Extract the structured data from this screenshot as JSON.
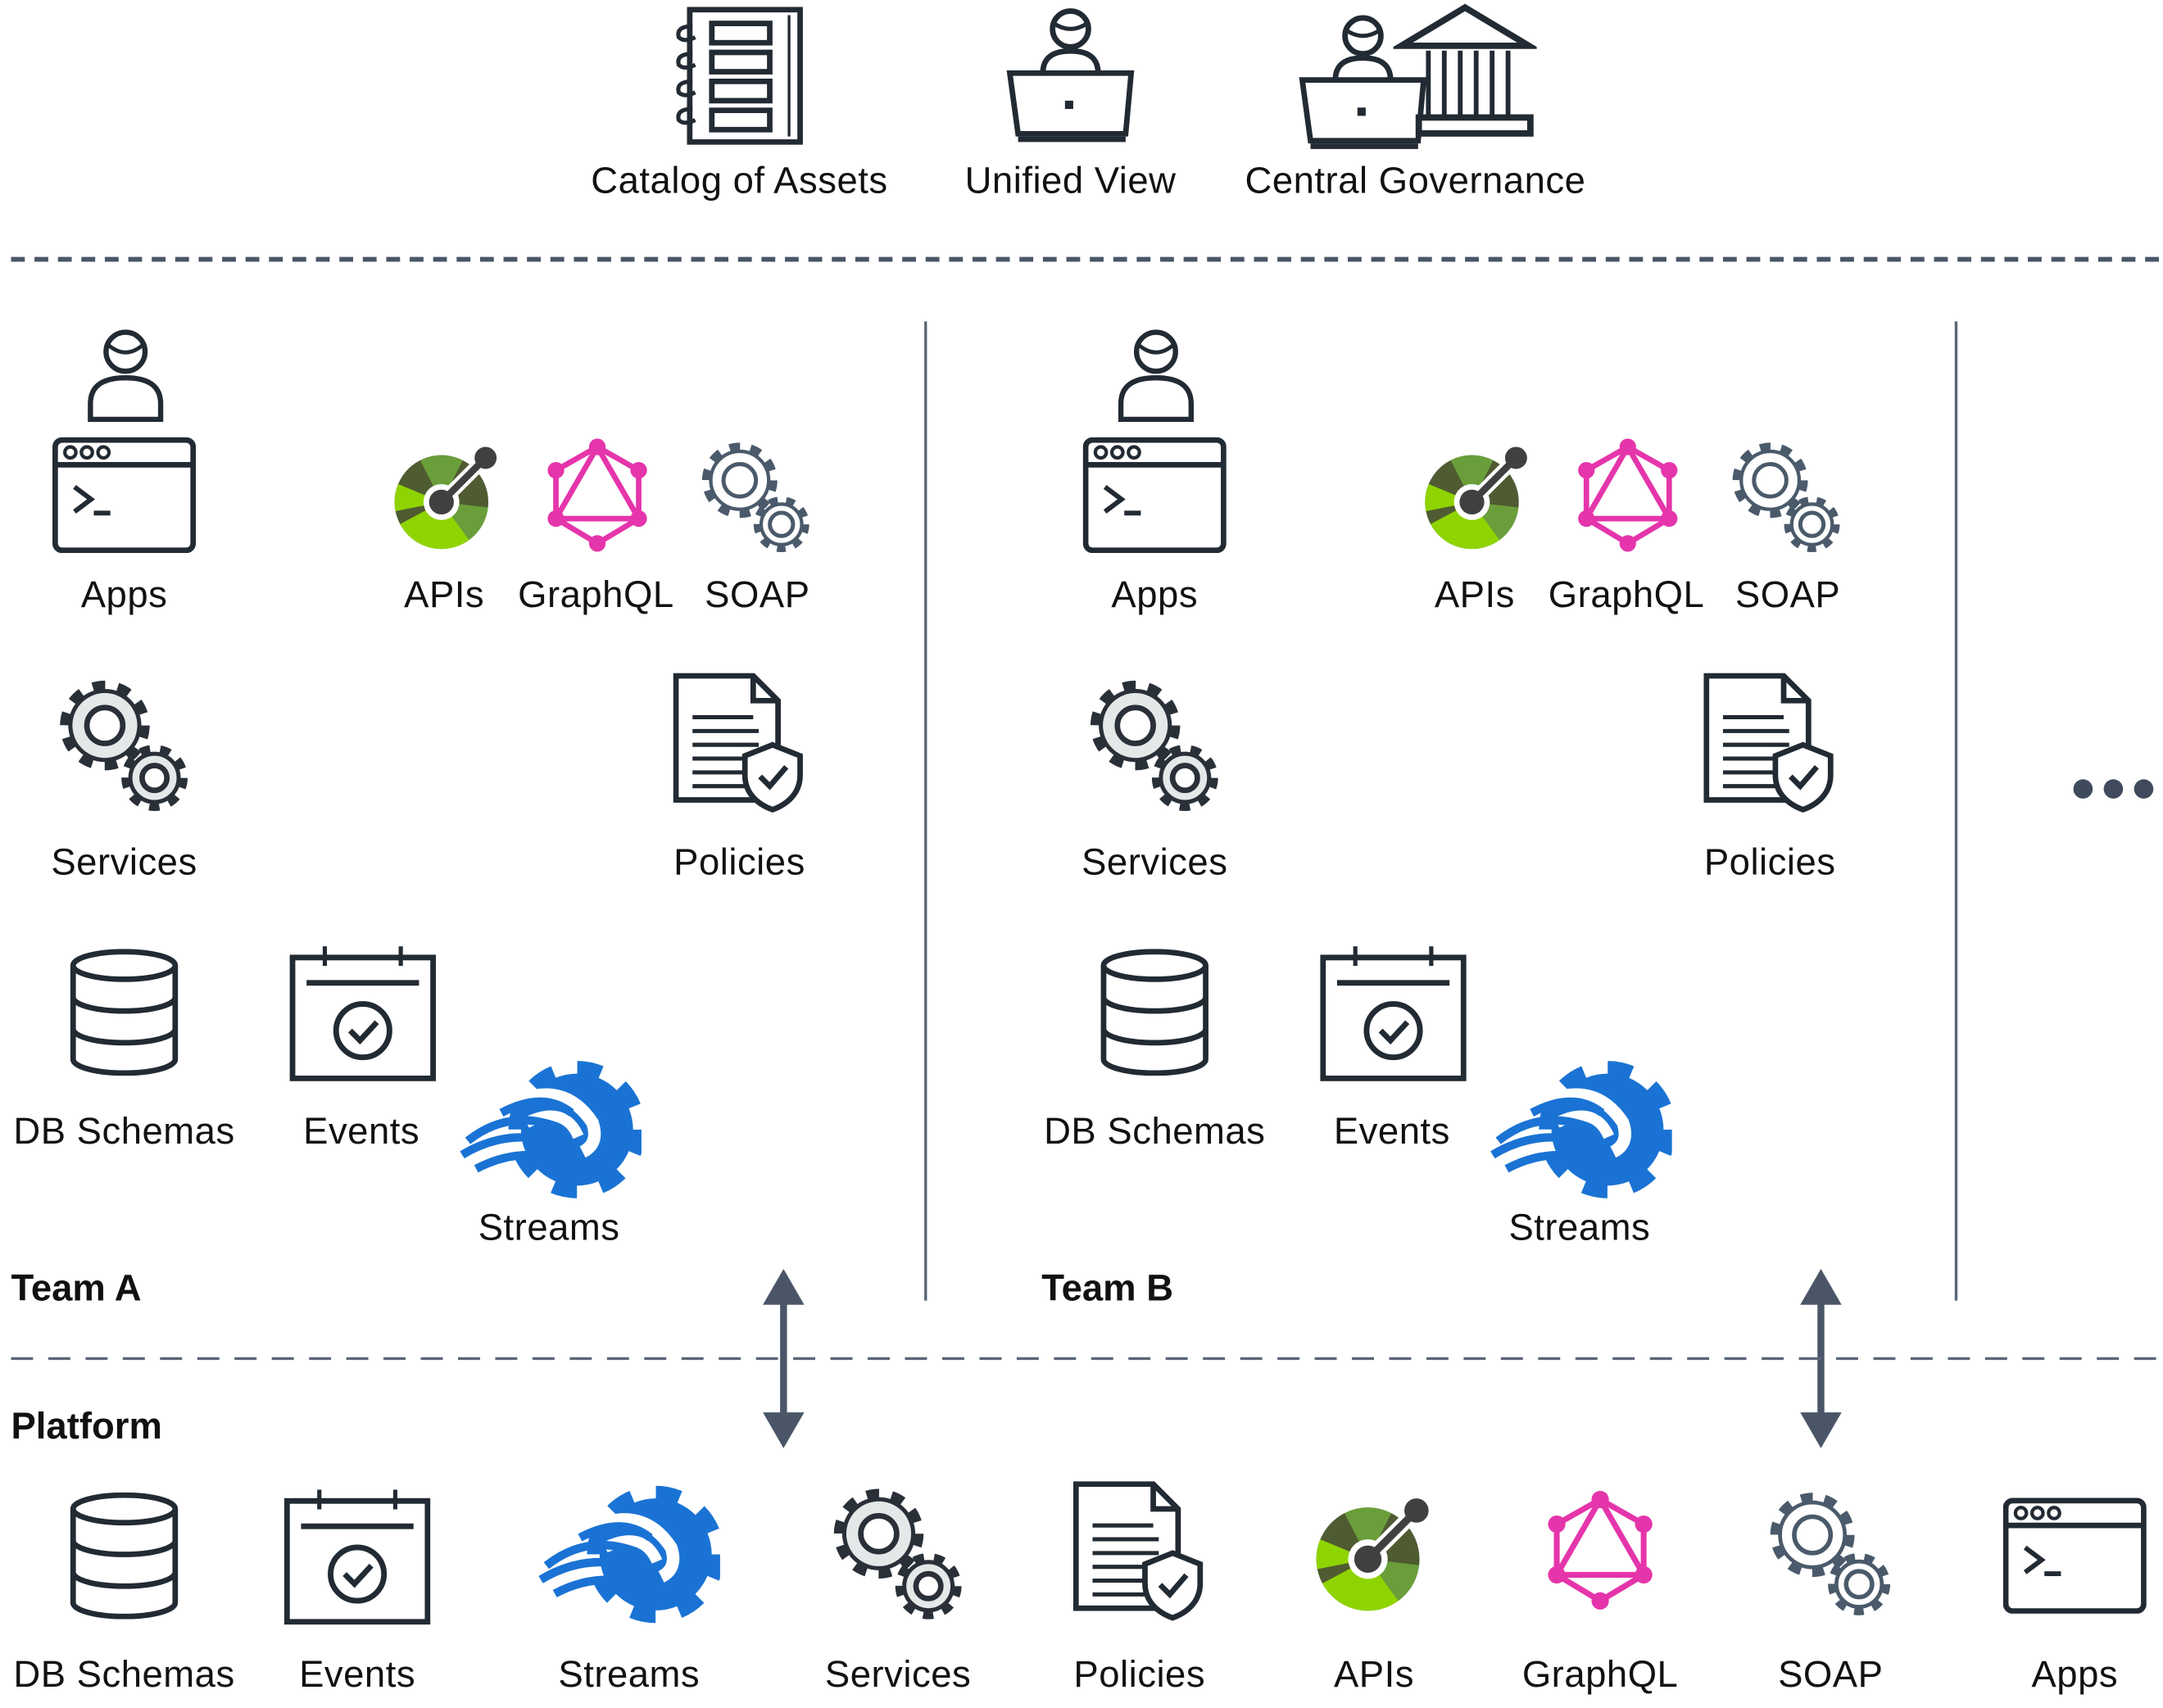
{
  "top": {
    "items": [
      {
        "label": "Catalog of Assets",
        "icon": "catalog-notebook-icon"
      },
      {
        "label": "Unified View",
        "icon": "person-laptop-icon"
      },
      {
        "label": "Central Governance",
        "icon": "person-laptop-building-icon"
      }
    ]
  },
  "teams": [
    {
      "name": "Team A",
      "apps": "Apps",
      "apis": "APIs",
      "graphql": "GraphQL",
      "soap": "SOAP",
      "services": "Services",
      "policies": "Policies",
      "db": "DB Schemas",
      "events": "Events",
      "streams": "Streams"
    },
    {
      "name": "Team B",
      "apps": "Apps",
      "apis": "APIs",
      "graphql": "GraphQL",
      "soap": "SOAP",
      "services": "Services",
      "policies": "Policies",
      "db": "DB Schemas",
      "events": "Events",
      "streams": "Streams"
    }
  ],
  "platform": {
    "title": "Platform",
    "items": [
      "DB Schemas",
      "Events",
      "Streams",
      "Services",
      "Policies",
      "APIs",
      "GraphQL",
      "SOAP",
      "Apps"
    ]
  },
  "colors": {
    "line": "#4a5668",
    "graphql": "#e535ab",
    "streams": "#1a73d4",
    "api_dark": "#4f5b31",
    "api_mid": "#6a9e3a",
    "api_lime": "#8fd400",
    "icon_dark": "#222a33"
  }
}
